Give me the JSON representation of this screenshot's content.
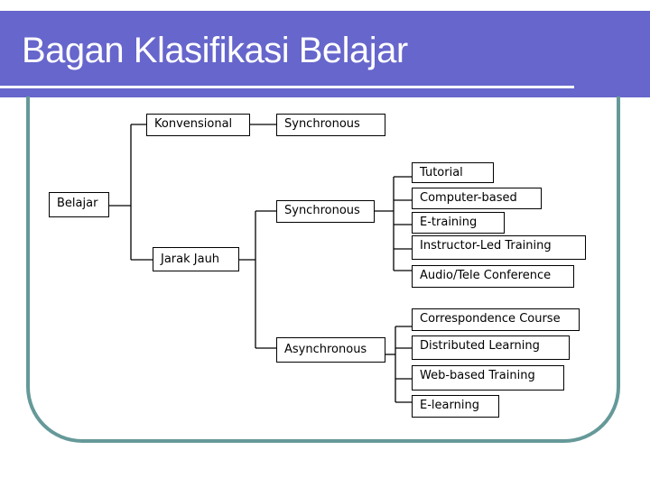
{
  "slide": {
    "title": "Bagan Klasifikasi Belajar",
    "colors": {
      "banner": "#6666cc",
      "frame": "#669999",
      "node_border": "#000000"
    }
  },
  "diagram": {
    "root": "Belajar",
    "level1": {
      "konvensional": "Konvensional",
      "jarak_jauh": "Jarak Jauh"
    },
    "konvensional_child": "Synchronous",
    "jarak_jauh_children": {
      "synchronous": "Synchronous",
      "asynchronous": "Asynchronous"
    },
    "synchronous_items": [
      "Tutorial",
      "Computer-based",
      "E-training",
      "Instructor-Led Training",
      "Audio/Tele Conference"
    ],
    "asynchronous_items": [
      "Correspondence Course",
      "Distributed Learning",
      "Web-based Training",
      "E-learning"
    ]
  }
}
